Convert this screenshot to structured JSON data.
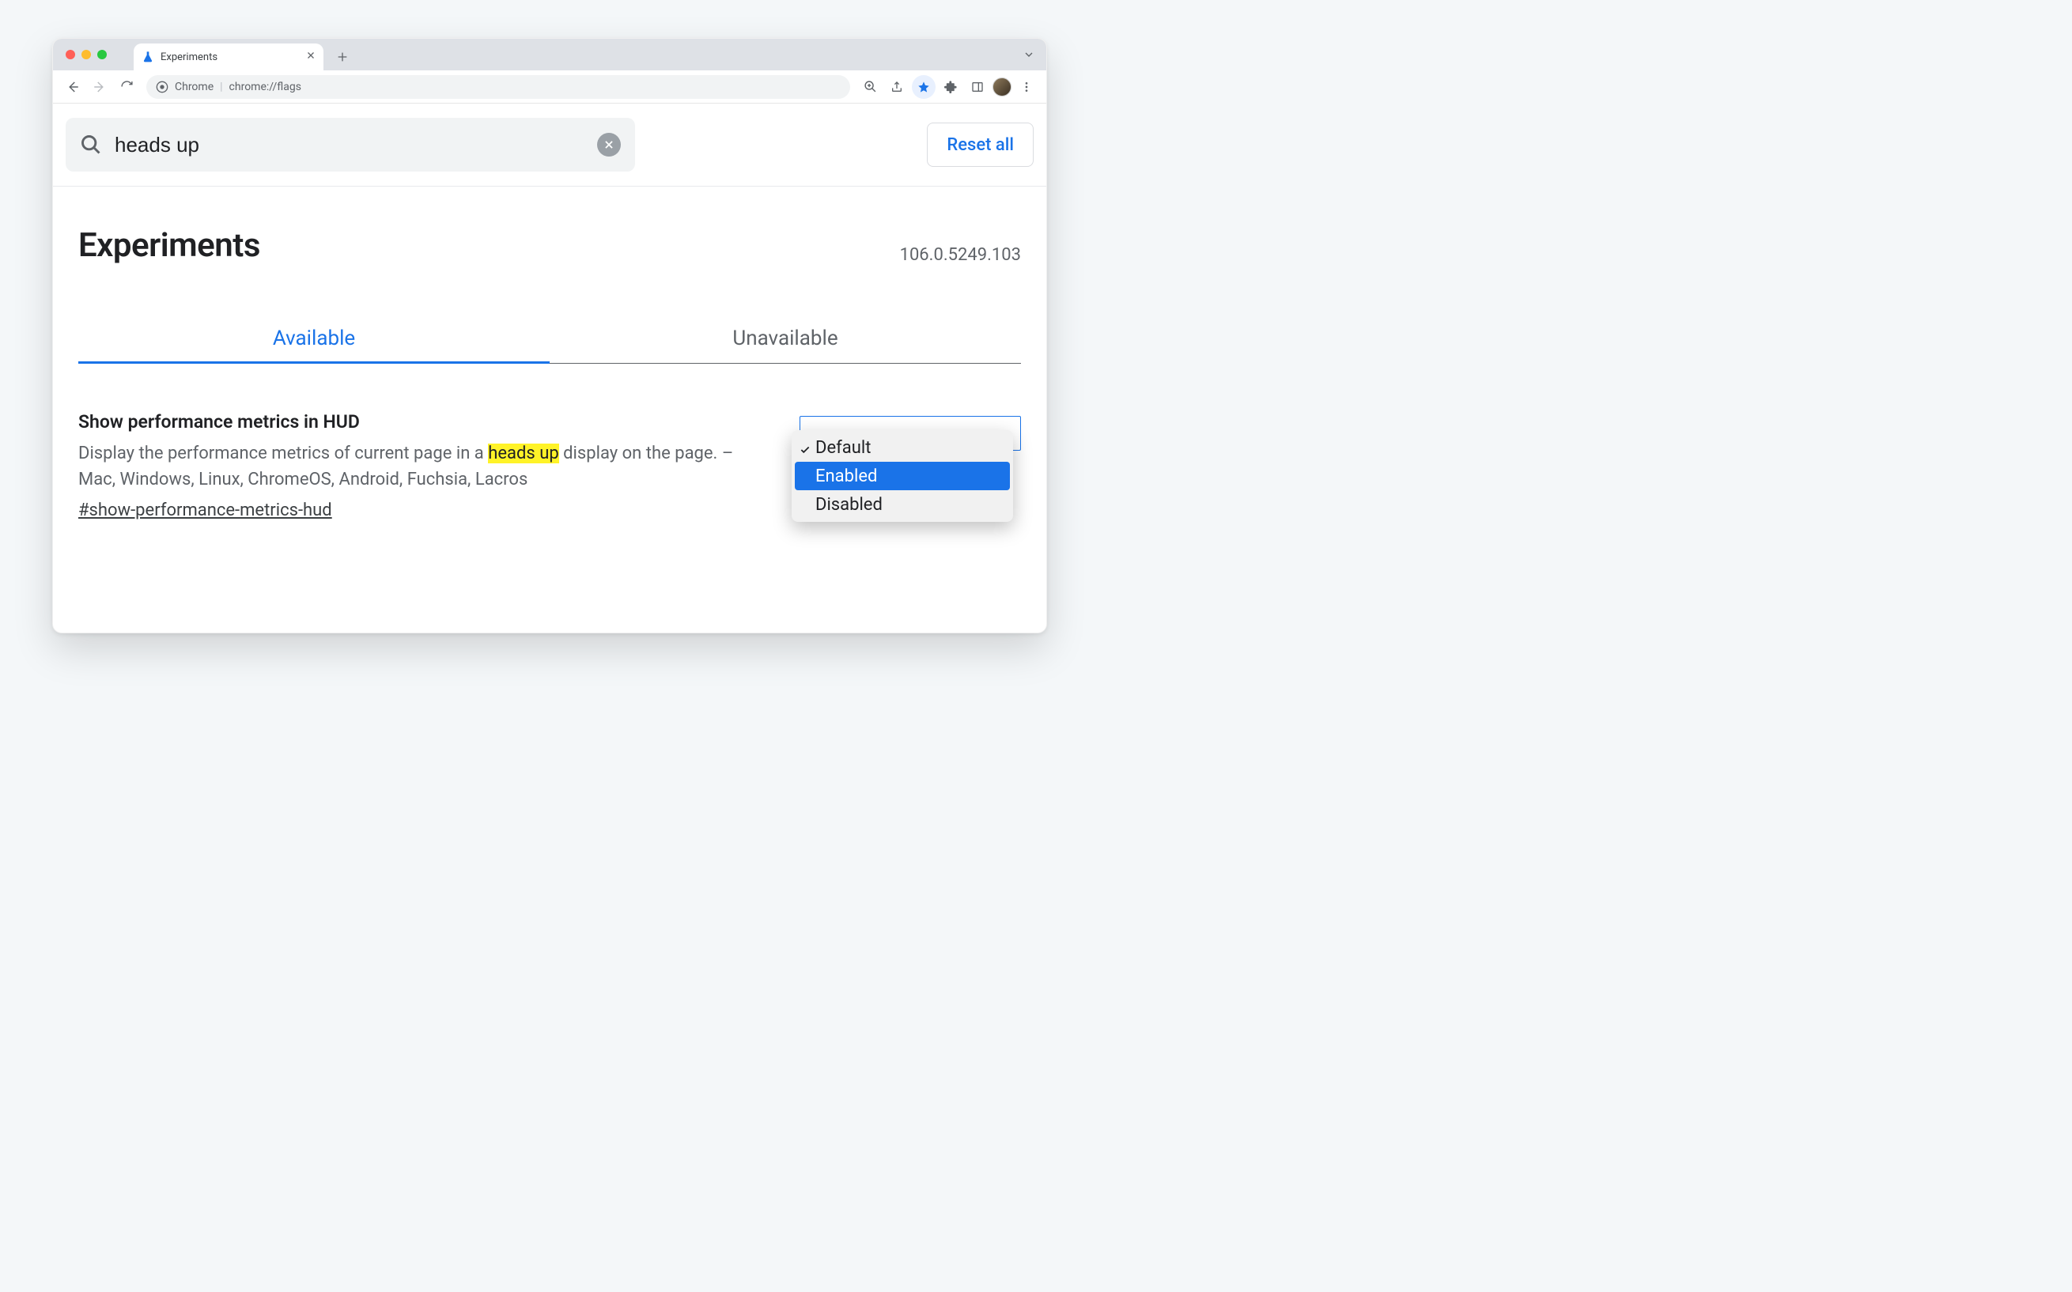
{
  "browser": {
    "tab_title": "Experiments",
    "omnibox_prefix": "Chrome",
    "omnibox_url": "chrome://flags"
  },
  "search": {
    "query": "heads up",
    "reset_label": "Reset all"
  },
  "page": {
    "heading": "Experiments",
    "version": "106.0.5249.103"
  },
  "tabs": {
    "available": "Available",
    "unavailable": "Unavailable"
  },
  "flag": {
    "title": "Show performance metrics in HUD",
    "desc_before": "Display the performance metrics of current page in a ",
    "desc_highlight": "heads up",
    "desc_after": " display on the page. – Mac, Windows, Linux, ChromeOS, Android, Fuchsia, Lacros",
    "anchor": "#show-performance-metrics-hud",
    "options": {
      "default": "Default",
      "enabled": "Enabled",
      "disabled": "Disabled"
    }
  }
}
